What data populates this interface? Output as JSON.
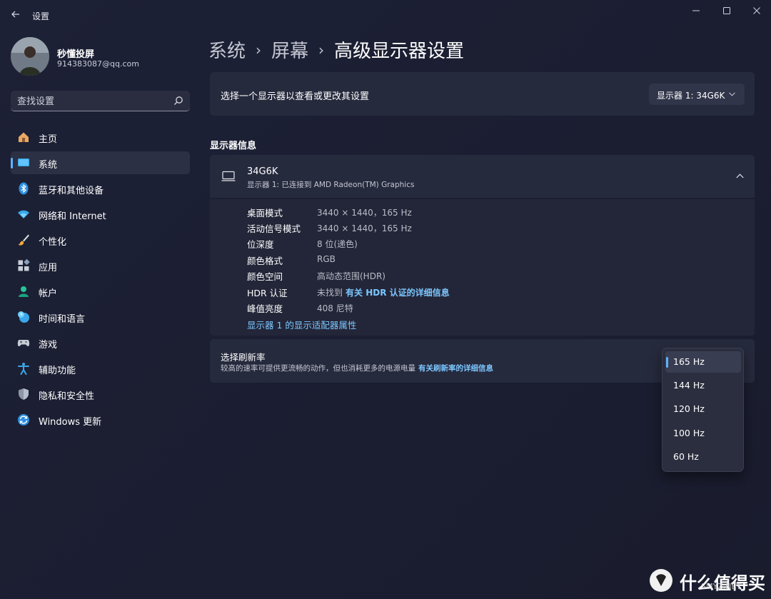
{
  "window": {
    "title": "设置"
  },
  "user": {
    "name": "秒懂投屏",
    "email": "914383087@qq.com"
  },
  "search": {
    "placeholder": "查找设置"
  },
  "sidebar": {
    "items": [
      {
        "label": "主页",
        "icon": "home-icon",
        "active": false
      },
      {
        "label": "系统",
        "icon": "system-display-icon",
        "active": true
      },
      {
        "label": "蓝牙和其他设备",
        "icon": "bluetooth-icon",
        "active": false
      },
      {
        "label": "网络和 Internet",
        "icon": "wifi-icon",
        "active": false
      },
      {
        "label": "个性化",
        "icon": "brush-icon",
        "active": false
      },
      {
        "label": "应用",
        "icon": "apps-icon",
        "active": false
      },
      {
        "label": "帐户",
        "icon": "account-icon",
        "active": false
      },
      {
        "label": "时间和语言",
        "icon": "time-language-icon",
        "active": false
      },
      {
        "label": "游戏",
        "icon": "gamepad-icon",
        "active": false
      },
      {
        "label": "辅助功能",
        "icon": "accessibility-icon",
        "active": false
      },
      {
        "label": "隐私和安全性",
        "icon": "shield-icon",
        "active": false
      },
      {
        "label": "Windows 更新",
        "icon": "update-icon",
        "active": false
      }
    ]
  },
  "breadcrumb": {
    "items": [
      "系统",
      "屏幕",
      "高级显示器设置"
    ],
    "separator": "›"
  },
  "monitor_select": {
    "label": "选择一个显示器以查看或更改其设置",
    "value": "显示器 1: 34G6K"
  },
  "display_info": {
    "section_title": "显示器信息",
    "monitor_name": "34G6K",
    "monitor_desc": "显示器 1: 已连接到 AMD Radeon(TM) Graphics",
    "rows": [
      {
        "key": "桌面模式",
        "value": "3440 × 1440，165 Hz"
      },
      {
        "key": "活动信号模式",
        "value": "3440 × 1440，165 Hz"
      },
      {
        "key": "位深度",
        "value": "8 位(递色)"
      },
      {
        "key": "颜色格式",
        "value": "RGB"
      },
      {
        "key": "颜色空间",
        "value": "高动态范围(HDR)"
      },
      {
        "key": "HDR 认证",
        "value": "未找到",
        "link": "有关 HDR 认证的详细信息"
      },
      {
        "key": "峰值亮度",
        "value": "408 尼特"
      }
    ],
    "adapter_link": "显示器 1 的显示适配器属性"
  },
  "refresh_rate": {
    "title": "选择刷新率",
    "desc": "较高的速率可提供更流畅的动作，但也消耗更多的电源电量",
    "link": "有关刷新率的详细信息",
    "options": [
      "165 Hz",
      "144 Hz",
      "120 Hz",
      "100 Hz",
      "60 Hz"
    ],
    "selected": "165 Hz"
  },
  "watermark": {
    "text": "什么值得买",
    "sub": "SMYZ.NET"
  },
  "colors": {
    "accent": "#5fb2ff",
    "link": "#7cc6ff",
    "background": "#1d2136",
    "card": "#262a3d"
  }
}
